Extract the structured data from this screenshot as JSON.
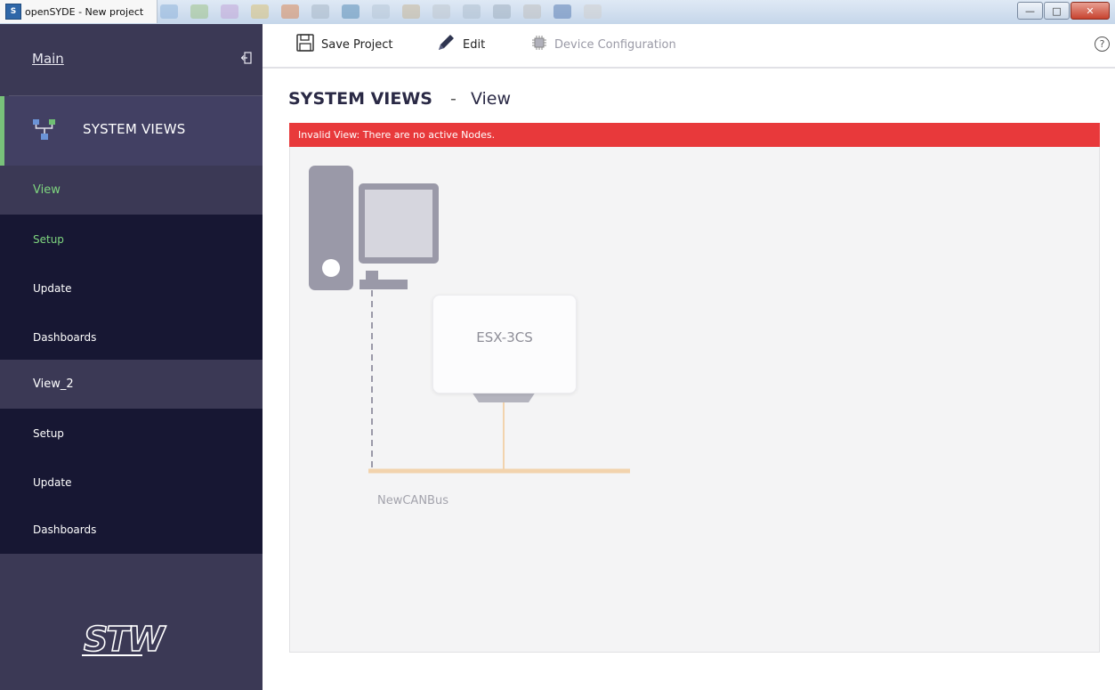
{
  "window": {
    "title": "openSYDE - New project",
    "app_icon_glyph": "S"
  },
  "sidebar": {
    "main_label": "Main",
    "section_label": "SYSTEM VIEWS",
    "views": [
      {
        "label": "View",
        "active": true,
        "items": [
          {
            "label": "Setup",
            "active": true
          },
          {
            "label": "Update",
            "active": false
          },
          {
            "label": "Dashboards",
            "active": false
          }
        ]
      },
      {
        "label": "View_2",
        "active": false,
        "items": [
          {
            "label": "Setup",
            "active": false
          },
          {
            "label": "Update",
            "active": false
          },
          {
            "label": "Dashboards",
            "active": false
          }
        ]
      }
    ],
    "logo_text": "STW"
  },
  "toolbar": {
    "save_label": "Save Project",
    "edit_label": "Edit",
    "device_config_label": "Device Configuration",
    "help_glyph": "?"
  },
  "page": {
    "title_main": "SYSTEM VIEWS",
    "title_separator": "-",
    "title_sub": "View"
  },
  "error": {
    "message": "Invalid View: There are no active Nodes."
  },
  "diagram": {
    "node_label": "ESX-3CS",
    "bus_label": "NewCANBus"
  },
  "colors": {
    "accent_green": "#78c27a",
    "error_red": "#e8393b",
    "bus_color": "#f2d3ad",
    "sidebar_dark": "#171733",
    "sidebar_mid": "#3b3955"
  }
}
